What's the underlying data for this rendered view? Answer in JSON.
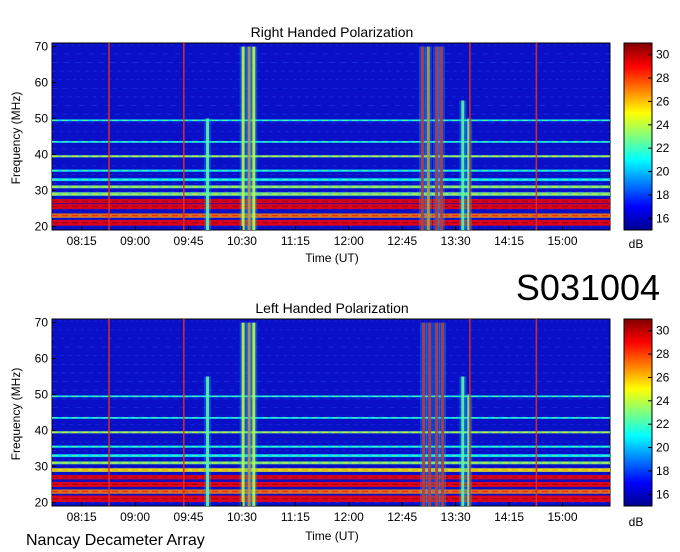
{
  "figure": {
    "code": "S031004",
    "footer": "Nancay Decameter Array"
  },
  "colormap": [
    "#00008f",
    "#0000ff",
    "#007fff",
    "#00ffff",
    "#7fff7f",
    "#ffff00",
    "#ff7f00",
    "#ff0000",
    "#7f0000"
  ],
  "chart_data": [
    {
      "type": "heatmap",
      "title": "Right Handed Polarization",
      "xlabel": "Time (UT)",
      "ylabel": "Frequency (MHz)",
      "xticks": [
        "08:15",
        "09:00",
        "09:45",
        "10:30",
        "11:15",
        "12:00",
        "12:45",
        "13:30",
        "14:15",
        "15:00"
      ],
      "xlim": [
        "07:50",
        "15:40"
      ],
      "yticks": [
        20,
        30,
        40,
        50,
        60,
        70
      ],
      "ylim": [
        19,
        71
      ],
      "colorbar": {
        "label": "dB",
        "ticks": [
          16,
          18,
          20,
          22,
          24,
          26,
          28,
          30
        ],
        "range": [
          15,
          31
        ]
      },
      "bands_MHz": [
        {
          "center": 21,
          "width": 1.6,
          "level": 29
        },
        {
          "center": 23,
          "width": 1.2,
          "level": 26
        },
        {
          "center": 25.5,
          "width": 1.4,
          "level": 28
        },
        {
          "center": 27,
          "width": 1.2,
          "level": 29
        },
        {
          "center": 29,
          "width": 1.0,
          "level": 23
        },
        {
          "center": 31,
          "width": 0.8,
          "level": 22
        },
        {
          "center": 33,
          "width": 0.8,
          "level": 21
        },
        {
          "center": 35.5,
          "width": 0.6,
          "level": 21
        },
        {
          "center": 39.5,
          "width": 0.6,
          "level": 22
        },
        {
          "center": 43.5,
          "width": 0.5,
          "level": 21
        },
        {
          "center": 49.5,
          "width": 0.5,
          "level": 21
        }
      ],
      "bursts": [
        {
          "time": "10:01",
          "fmax": 50,
          "level": 22
        },
        {
          "time": "10:31",
          "fmax": 70,
          "level": 24
        },
        {
          "time": "10:36",
          "fmax": 70,
          "level": 26
        },
        {
          "time": "10:40",
          "fmax": 70,
          "level": 25
        },
        {
          "time": "13:02",
          "fmax": 70,
          "level": 28
        },
        {
          "time": "13:07",
          "fmax": 70,
          "level": 27
        },
        {
          "time": "13:14",
          "fmax": 70,
          "level": 29
        },
        {
          "time": "13:18",
          "fmax": 70,
          "level": 28
        },
        {
          "time": "13:36",
          "fmax": 55,
          "level": 23
        },
        {
          "time": "13:41",
          "fmax": 50,
          "level": 22
        }
      ],
      "vertical_lines": [
        "08:38",
        "09:41",
        "13:42",
        "14:38"
      ]
    },
    {
      "type": "heatmap",
      "title": "Left Handed Polarization",
      "xlabel": "Time (UT)",
      "ylabel": "Frequency (MHz)",
      "xticks": [
        "08:15",
        "09:00",
        "09:45",
        "10:30",
        "11:15",
        "12:00",
        "12:45",
        "13:30",
        "14:15",
        "15:00"
      ],
      "xlim": [
        "07:50",
        "15:40"
      ],
      "yticks": [
        20,
        30,
        40,
        50,
        60,
        70
      ],
      "ylim": [
        19,
        71
      ],
      "colorbar": {
        "label": "dB",
        "ticks": [
          16,
          18,
          20,
          22,
          24,
          26,
          28,
          30
        ],
        "range": [
          15,
          31
        ]
      },
      "bands_MHz": [
        {
          "center": 21,
          "width": 1.8,
          "level": 29
        },
        {
          "center": 23,
          "width": 1.2,
          "level": 27
        },
        {
          "center": 25,
          "width": 1.4,
          "level": 28
        },
        {
          "center": 27,
          "width": 1.2,
          "level": 29
        },
        {
          "center": 29,
          "width": 1.0,
          "level": 24
        },
        {
          "center": 31,
          "width": 0.8,
          "level": 22
        },
        {
          "center": 33,
          "width": 0.8,
          "level": 21
        },
        {
          "center": 35.5,
          "width": 0.6,
          "level": 21
        },
        {
          "center": 39.5,
          "width": 0.6,
          "level": 22
        },
        {
          "center": 43.5,
          "width": 0.5,
          "level": 21
        },
        {
          "center": 49.5,
          "width": 0.5,
          "level": 21
        }
      ],
      "bursts": [
        {
          "time": "10:01",
          "fmax": 55,
          "level": 22
        },
        {
          "time": "10:31",
          "fmax": 70,
          "level": 25
        },
        {
          "time": "10:36",
          "fmax": 70,
          "level": 27
        },
        {
          "time": "10:40",
          "fmax": 70,
          "level": 25
        },
        {
          "time": "13:03",
          "fmax": 70,
          "level": 29
        },
        {
          "time": "13:08",
          "fmax": 70,
          "level": 28
        },
        {
          "time": "13:14",
          "fmax": 70,
          "level": 29
        },
        {
          "time": "13:19",
          "fmax": 70,
          "level": 28
        },
        {
          "time": "13:36",
          "fmax": 55,
          "level": 23
        },
        {
          "time": "13:41",
          "fmax": 50,
          "level": 22
        }
      ],
      "vertical_lines": [
        "08:38",
        "09:41",
        "13:42",
        "14:38"
      ]
    }
  ]
}
